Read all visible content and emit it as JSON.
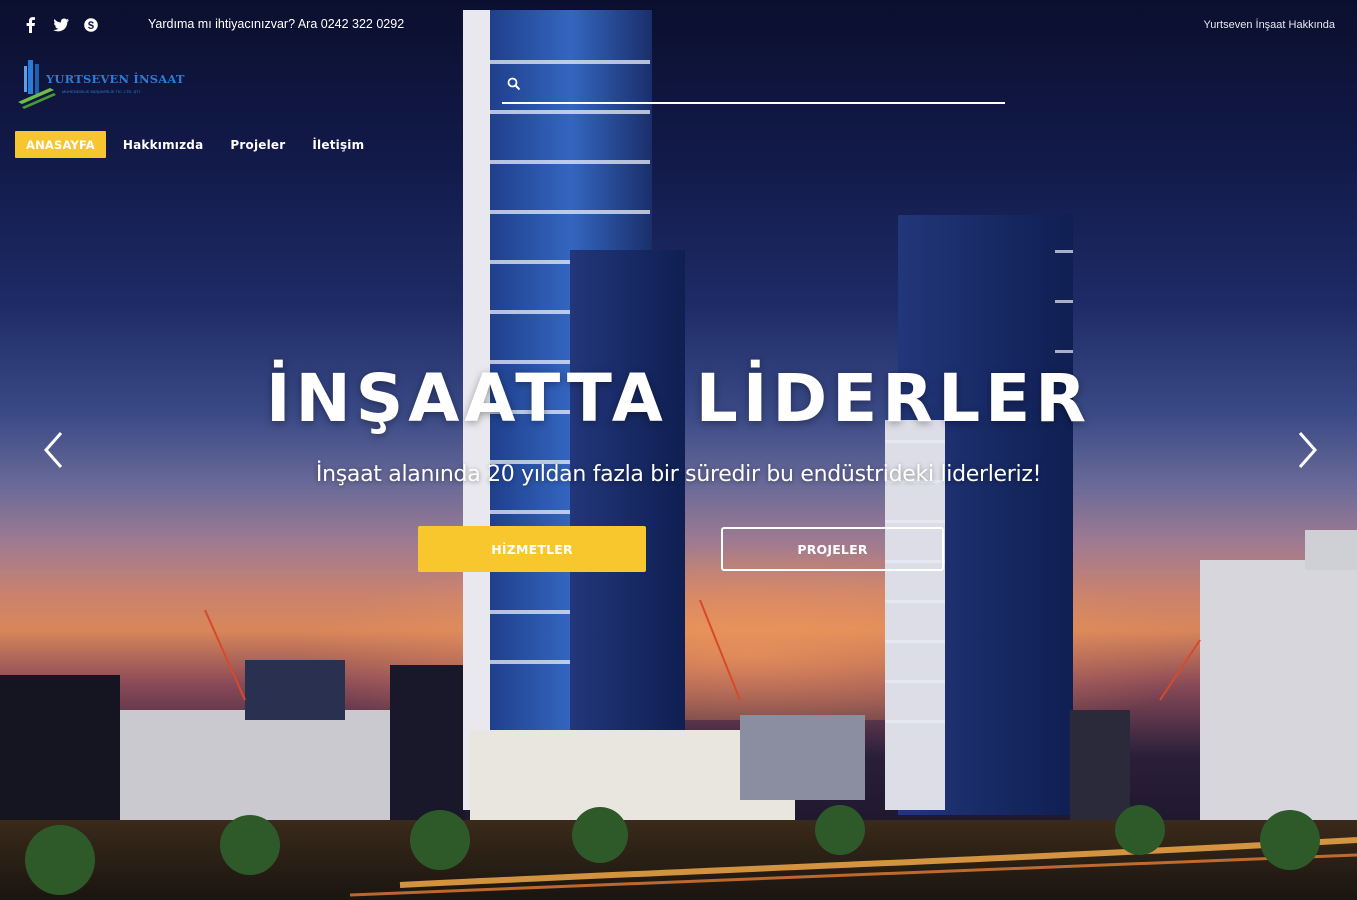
{
  "topbar": {
    "social": [
      {
        "icon": "facebook-icon"
      },
      {
        "icon": "twitter-icon"
      },
      {
        "icon": "skype-icon"
      }
    ],
    "help_text": "Yardıma mı ihtiyacınızvar? Ara 0242 322 0292",
    "about_link": "Yurtseven İnşaat Hakkında"
  },
  "logo": {
    "name": "YURTSEVEN İNSAAT",
    "tagline": "MÜHENDİSLİK MÜŞAVİRLİK TİC. LTD. ŞTİ."
  },
  "search": {
    "placeholder": "",
    "value": ""
  },
  "nav": {
    "items": [
      {
        "label": "ANASAYFA",
        "active": true
      },
      {
        "label": "Hakkımızda",
        "active": false
      },
      {
        "label": "Projeler",
        "active": false
      },
      {
        "label": "İletişim",
        "active": false
      }
    ]
  },
  "hero": {
    "headline": "İNŞAATTA LİDERLER",
    "subline": "İnşaat alanında 20 yıldan fazla bir süredir bu endüstrideki liderleriz!",
    "primary_button": "HİZMETLER",
    "secondary_button": "PROJELER"
  },
  "colors": {
    "accent": "#f8c72d",
    "logo_blue": "#2a7cd8",
    "logo_green": "#6cc04a"
  }
}
